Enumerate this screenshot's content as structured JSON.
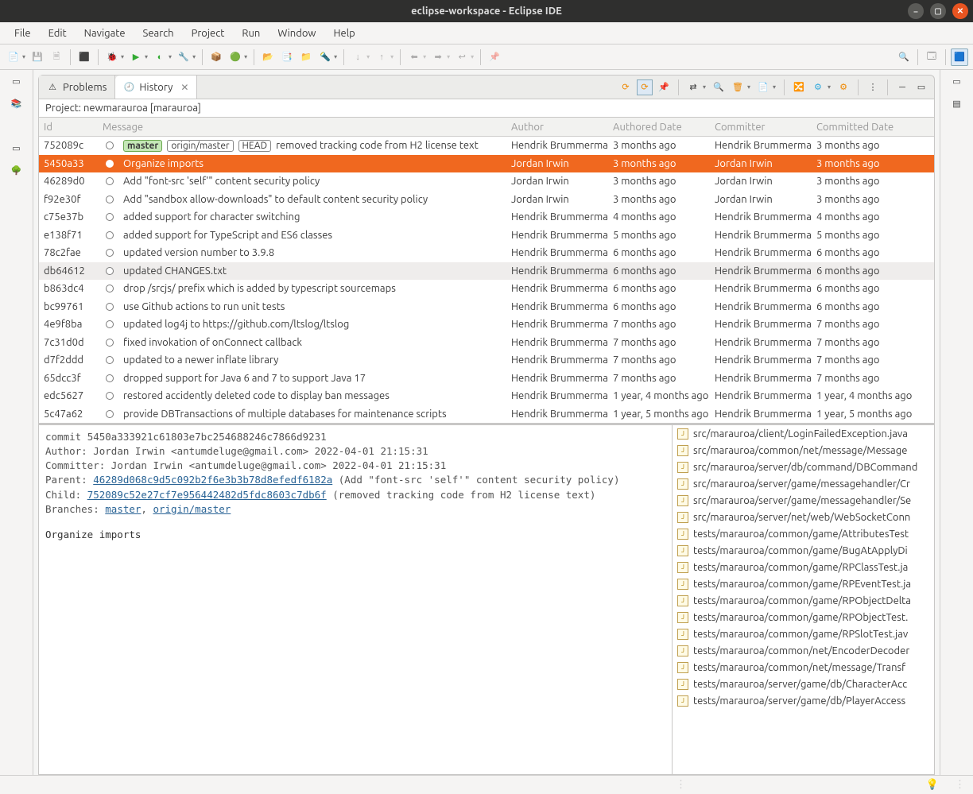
{
  "window": {
    "title": "eclipse-workspace - Eclipse IDE"
  },
  "menubar": [
    "File",
    "Edit",
    "Navigate",
    "Search",
    "Project",
    "Run",
    "Window",
    "Help"
  ],
  "tabs": {
    "problems": {
      "label": "Problems"
    },
    "history": {
      "label": "History"
    }
  },
  "projectLine": "Project: newmarauroa [marauroa]",
  "columns": {
    "id": "Id",
    "message": "Message",
    "author": "Author",
    "adate": "Authored Date",
    "committer": "Committer",
    "cdate": "Committed Date"
  },
  "refs": {
    "master": "master",
    "origin": "origin/master",
    "head": "HEAD"
  },
  "commits": [
    {
      "id": "752089c",
      "msg": "removed tracking code from H2 license text",
      "author": "Hendrik Brummermann",
      "adate": "3 months ago",
      "committer": "Hendrik Brummermann",
      "cdate": "3 months ago",
      "refs": true
    },
    {
      "id": "5450a33",
      "msg": "Organize imports",
      "author": "Jordan Irwin",
      "adate": "3 months ago",
      "committer": "Jordan Irwin",
      "cdate": "3 months ago",
      "selected": true
    },
    {
      "id": "46289d0",
      "msg": "Add \"font-src 'self'\" content security policy",
      "author": "Jordan Irwin",
      "adate": "3 months ago",
      "committer": "Jordan Irwin",
      "cdate": "3 months ago"
    },
    {
      "id": "f92e30f",
      "msg": "Add \"sandbox allow-downloads\" to default content security policy",
      "author": "Jordan Irwin",
      "adate": "3 months ago",
      "committer": "Jordan Irwin",
      "cdate": "3 months ago"
    },
    {
      "id": "c75e37b",
      "msg": "added support for character switching",
      "author": "Hendrik Brummermann",
      "adate": "4 months ago",
      "committer": "Hendrik Brummermann",
      "cdate": "4 months ago"
    },
    {
      "id": "e138f71",
      "msg": "added support for TypeScript and ES6 classes",
      "author": "Hendrik Brummermann",
      "adate": "5 months ago",
      "committer": "Hendrik Brummermann",
      "cdate": "5 months ago"
    },
    {
      "id": "78c2fae",
      "msg": "updated version number to 3.9.8",
      "author": "Hendrik Brummermann",
      "adate": "6 months ago",
      "committer": "Hendrik Brummermann",
      "cdate": "6 months ago"
    },
    {
      "id": "db64612",
      "msg": "updated CHANGES.txt",
      "author": "Hendrik Brummermann",
      "adate": "6 months ago",
      "committer": "Hendrik Brummermann",
      "cdate": "6 months ago",
      "hover": true
    },
    {
      "id": "b863dc4",
      "msg": "drop /srcjs/ prefix which is added by typescript sourcemaps",
      "author": "Hendrik Brummermann",
      "adate": "6 months ago",
      "committer": "Hendrik Brummermann",
      "cdate": "6 months ago"
    },
    {
      "id": "bc99761",
      "msg": "use Github actions to run unit tests",
      "author": "Hendrik Brummermann",
      "adate": "6 months ago",
      "committer": "Hendrik Brummermann",
      "cdate": "6 months ago"
    },
    {
      "id": "4e9f8ba",
      "msg": "updated log4j to https://github.com/ltslog/ltslog",
      "author": "Hendrik Brummermann",
      "adate": "7 months ago",
      "committer": "Hendrik Brummermann",
      "cdate": "7 months ago"
    },
    {
      "id": "7c31d0d",
      "msg": "fixed invokation of onConnect callback",
      "author": "Hendrik Brummermann",
      "adate": "7 months ago",
      "committer": "Hendrik Brummermann",
      "cdate": "7 months ago"
    },
    {
      "id": "d7f2ddd",
      "msg": "updated to a newer inflate library",
      "author": "Hendrik Brummermann",
      "adate": "7 months ago",
      "committer": "Hendrik Brummermann",
      "cdate": "7 months ago"
    },
    {
      "id": "65dcc3f",
      "msg": "dropped support for Java 6 and 7 to support Java 17",
      "author": "Hendrik Brummermann",
      "adate": "7 months ago",
      "committer": "Hendrik Brummermann",
      "cdate": "7 months ago"
    },
    {
      "id": "edc5627",
      "msg": "restored accidently deleted code to display ban messages",
      "author": "Hendrik Brummermann",
      "adate": "1 year, 4 months ago",
      "committer": "Hendrik Brummermann",
      "cdate": "1 year, 4 months ago"
    },
    {
      "id": "5c47a62",
      "msg": "provide DBTransactions of multiple databases for maintenance scripts",
      "author": "Hendrik Brummermann",
      "adate": "1 year, 5 months ago",
      "committer": "Hendrik Brummermann",
      "cdate": "1 year, 5 months ago"
    }
  ],
  "details": {
    "commitLabel": "commit ",
    "commit": "5450a333921c61803e7bc254688246c7866d9231",
    "authorLabel": "Author: ",
    "author": "Jordan Irwin <antumdeluge@gmail.com> 2022-04-01 21:15:31",
    "committerLabel": "Committer: ",
    "committer": "Jordan Irwin <antumdeluge@gmail.com> 2022-04-01 21:15:31",
    "parentLabel": "Parent: ",
    "parentHash": "46289d068c9d5c092b2f6e3b3b78d8efedf6182a",
    "parentMsg": " (Add \"font-src 'self'\" content security policy)",
    "childLabel": "Child: ",
    "childHash": "752089c52e27cf7e956442482d5fdc8603c7db6f",
    "childMsg": " (removed tracking code from H2 license text)",
    "branchesLabel": "Branches: ",
    "branch1": "master",
    "branchSep": ", ",
    "branch2": "origin/master",
    "body": "Organize imports"
  },
  "files": [
    "src/marauroa/client/LoginFailedException.java",
    "src/marauroa/common/net/message/Message",
    "src/marauroa/server/db/command/DBCommand",
    "src/marauroa/server/game/messagehandler/Cr",
    "src/marauroa/server/game/messagehandler/Se",
    "src/marauroa/server/net/web/WebSocketConn",
    "tests/marauroa/common/game/AttributesTest",
    "tests/marauroa/common/game/BugAtApplyDi",
    "tests/marauroa/common/game/RPClassTest.ja",
    "tests/marauroa/common/game/RPEventTest.ja",
    "tests/marauroa/common/game/RPObjectDelta",
    "tests/marauroa/common/game/RPObjectTest.",
    "tests/marauroa/common/game/RPSlotTest.jav",
    "tests/marauroa/common/net/EncoderDecoder",
    "tests/marauroa/common/net/message/Transf",
    "tests/marauroa/server/game/db/CharacterAcc",
    "tests/marauroa/server/game/db/PlayerAccess"
  ]
}
